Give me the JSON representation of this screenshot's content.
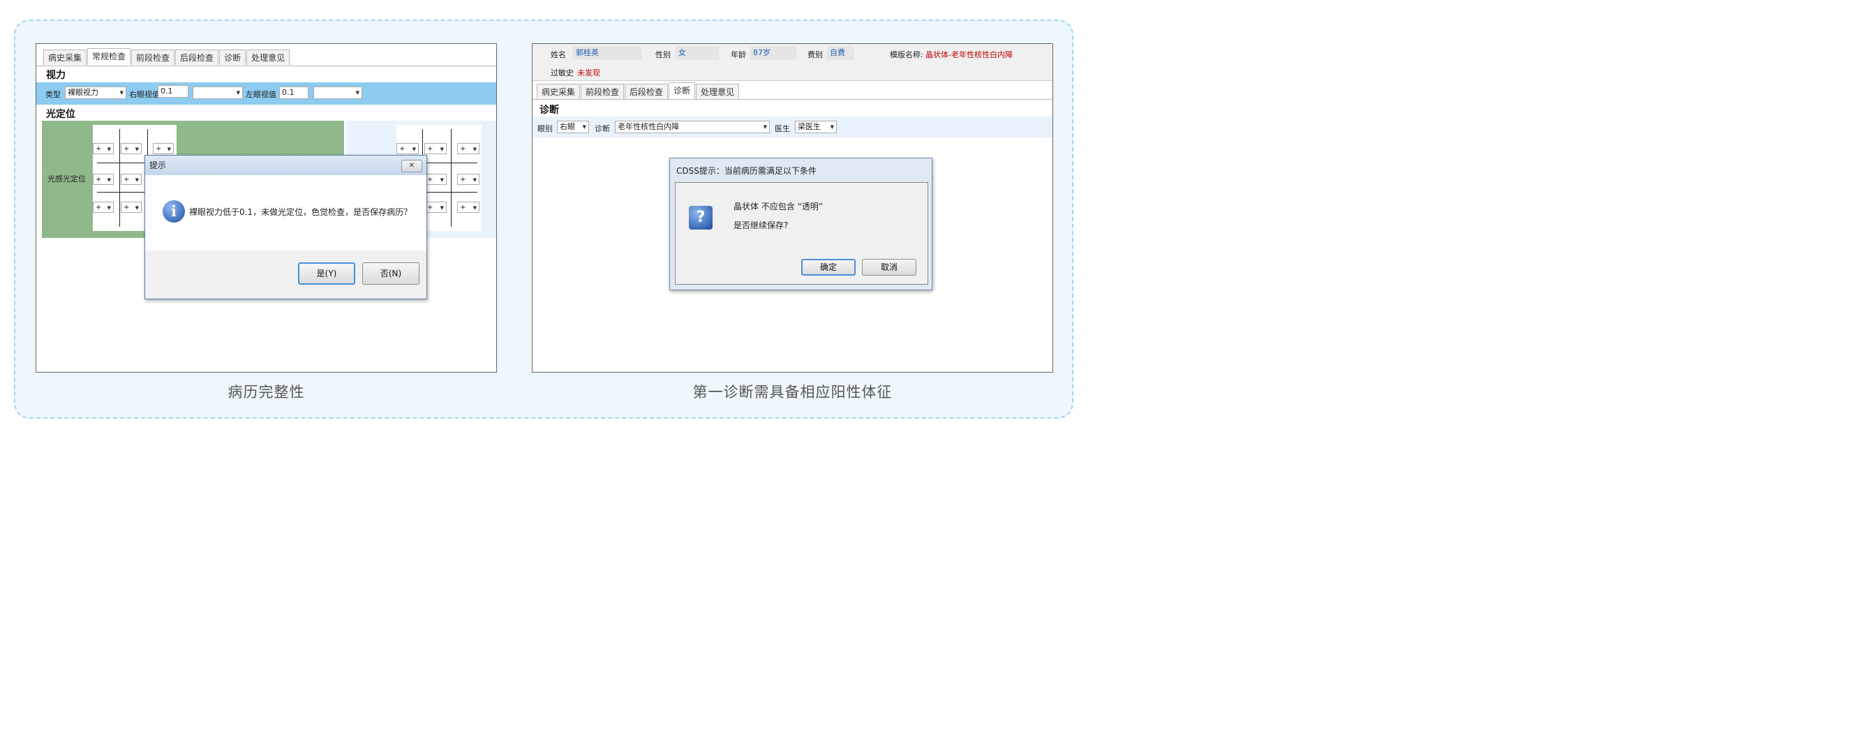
{
  "left_panel": {
    "caption": "病历完整性",
    "tabs": [
      "病史采集",
      "常规检查",
      "前段检查",
      "后段检查",
      "诊断",
      "处理意见"
    ],
    "active_tab": 1,
    "section_vision": "视力",
    "vision_row": {
      "type_label": "类型",
      "type_value": "裸眼视力",
      "right_eye_label": "右眼视值",
      "right_eye_value": "0.1",
      "left_eye_label": "左眼视值",
      "left_eye_value": "0.1"
    },
    "section_light": "光定位",
    "light_row_label": "光感光定位",
    "cell_symbol": "+",
    "dialog": {
      "title": "提示",
      "close_symbol": "✕",
      "message": "裸眼视力低于0.1，未做光定位，色觉检查，是否保存病历？",
      "yes_label": "是(Y)",
      "no_label": "否(N)",
      "icon": "info-icon"
    }
  },
  "right_panel": {
    "caption": "第一诊断需具备相应阳性体征",
    "patient": {
      "name_label": "姓名",
      "name_value": "郭桂英",
      "sex_label": "性别",
      "sex_value": "女",
      "age_label": "年龄",
      "age_value": "87岁",
      "fee_label": "费别",
      "fee_value": "自费",
      "template_label": "模版名称:",
      "template_value": "晶状体-老年性核性白内障",
      "allergy_label": "过敏史",
      "allergy_value": "未发现"
    },
    "tabs": [
      "病史采集",
      "前段检查",
      "后段检查",
      "诊断",
      "处理意见"
    ],
    "active_tab": 3,
    "section_diag": "诊断",
    "diag_row": {
      "eye_label": "眼别",
      "eye_value": "右眼",
      "diag_label": "诊断",
      "diag_value": "老年性核性白内障",
      "doctor_label": "医生",
      "doctor_value": "梁医生"
    },
    "dialog": {
      "title": "CDSS提示：当前病历需满足以下条件",
      "line1": "晶状体 不应包含 “透明”",
      "line2": "是否继续保存?",
      "ok_label": "确定",
      "cancel_label": "取消",
      "icon": "question-icon"
    }
  },
  "colors": {
    "frame_border": "#9fd6ee",
    "frame_bg": "#eef7fc",
    "blue_bar": "#8dcbf0",
    "green_area": "#8fb98a",
    "red_text": "#c00000",
    "blue_text": "#1f5fb5"
  }
}
